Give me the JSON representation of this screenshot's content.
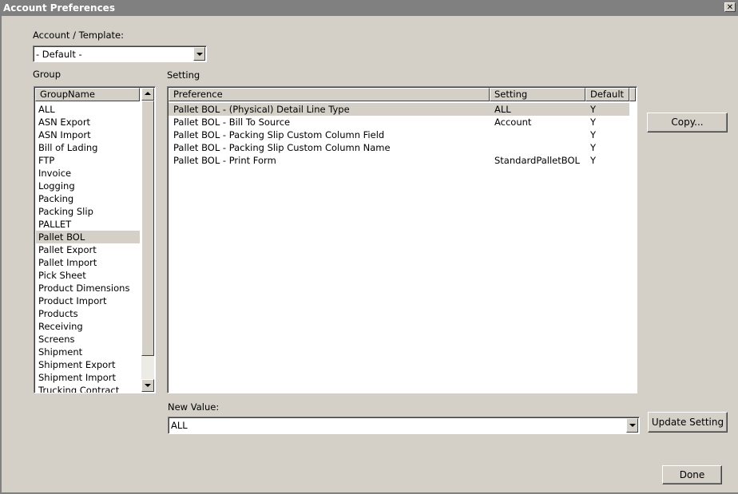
{
  "window": {
    "title": "Account Preferences",
    "close_glyph": "✕"
  },
  "account": {
    "label": "Account / Template:",
    "selected": "- Default -"
  },
  "group": {
    "label": "Group",
    "column_header": "GroupName",
    "selected_index": 10,
    "items": [
      "ALL",
      "ASN Export",
      "ASN Import",
      "Bill of Lading",
      "FTP",
      "Invoice",
      "Logging",
      "Packing",
      "Packing Slip",
      "PALLET",
      "Pallet BOL",
      "Pallet Export",
      "Pallet Import",
      "Pick Sheet",
      "Product Dimensions",
      "Product Import",
      "Products",
      "Receiving",
      "Screens",
      "Shipment",
      "Shipment Export",
      "Shipment Import",
      "Trucking Contract"
    ]
  },
  "setting": {
    "label": "Setting",
    "columns": [
      "Preference",
      "Setting",
      "Default"
    ],
    "selected_index": 0,
    "rows": [
      {
        "preference": "Pallet BOL - (Physical) Detail Line Type",
        "setting": "ALL",
        "default": "Y"
      },
      {
        "preference": "Pallet BOL - Bill To Source",
        "setting": "Account",
        "default": "Y"
      },
      {
        "preference": "Pallet BOL - Packing Slip Custom Column Field",
        "setting": "",
        "default": "Y"
      },
      {
        "preference": "Pallet BOL - Packing Slip Custom Column Name",
        "setting": "",
        "default": "Y"
      },
      {
        "preference": "Pallet BOL - Print Form",
        "setting": "StandardPalletBOL",
        "default": "Y"
      }
    ]
  },
  "new_value": {
    "label": "New Value:",
    "selected": "ALL"
  },
  "buttons": {
    "copy": "Copy...",
    "update": "Update Setting",
    "done": "Done"
  }
}
